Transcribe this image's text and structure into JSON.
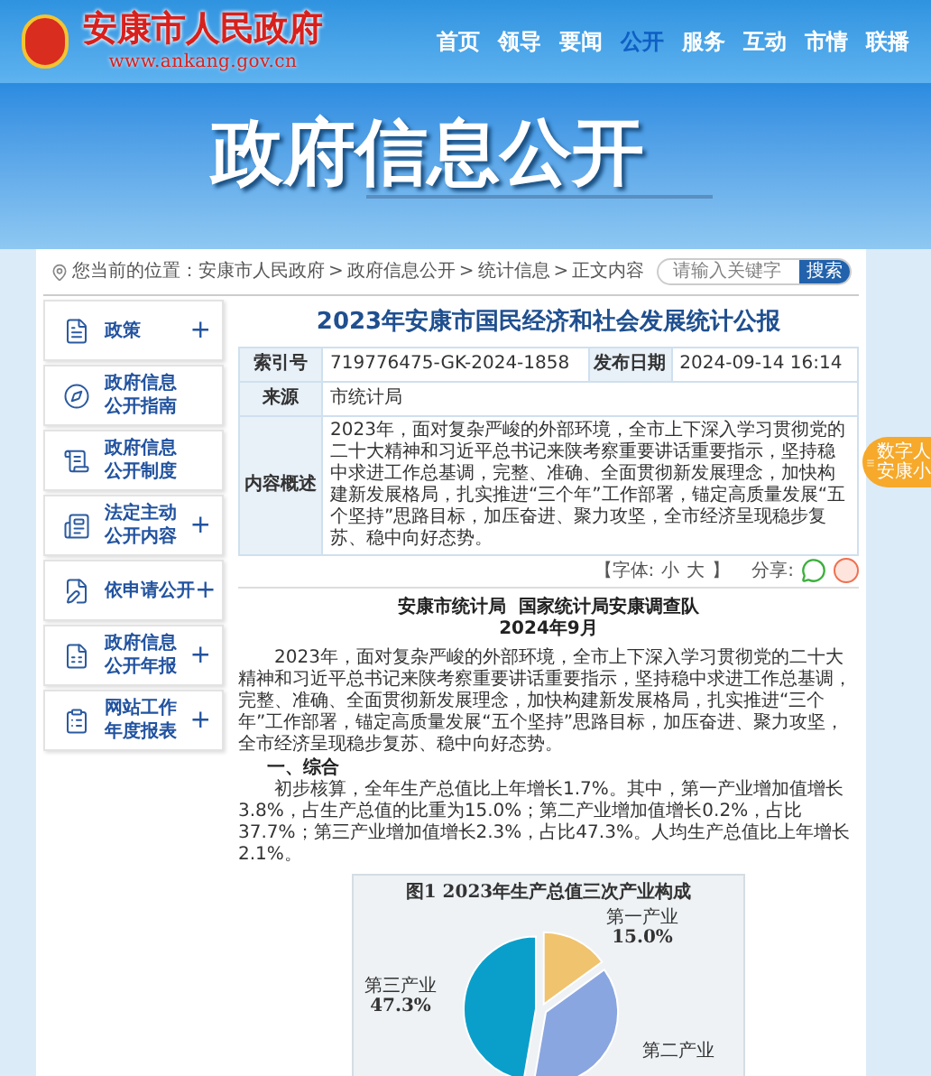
{
  "site": {
    "name": "安康市人民政府",
    "url": "www.ankang.gov.cn"
  },
  "nav": [
    {
      "label": "首页",
      "selected": false
    },
    {
      "label": "领导",
      "selected": false
    },
    {
      "label": "要闻",
      "selected": false
    },
    {
      "label": "公开",
      "selected": true
    },
    {
      "label": "服务",
      "selected": false
    },
    {
      "label": "互动",
      "selected": false
    },
    {
      "label": "市情",
      "selected": false
    },
    {
      "label": "联播",
      "selected": false
    }
  ],
  "banner": {
    "title": "政府信息公开"
  },
  "breadcrumb": {
    "label": "您当前的位置：",
    "items": [
      "安康市人民政府",
      "政府信息公开",
      "统计信息",
      "正文内容"
    ],
    "separator": ">"
  },
  "search": {
    "placeholder": "请输入关键字",
    "button": "搜索"
  },
  "sidebar": {
    "items": [
      {
        "lines": [
          "政策"
        ],
        "toggle": "+"
      },
      {
        "lines": [
          "政府信息",
          "公开指南"
        ]
      },
      {
        "lines": [
          "政府信息",
          "公开制度"
        ]
      },
      {
        "lines": [
          "法定主动",
          "公开内容"
        ],
        "toggle": "+"
      },
      {
        "lines": [
          "依申请公开"
        ],
        "toggle": "+"
      },
      {
        "lines": [
          "政府信息",
          "公开年报"
        ],
        "toggle": "+"
      },
      {
        "lines": [
          "网站工作",
          "年度报表"
        ],
        "toggle": "+"
      }
    ]
  },
  "article": {
    "title": "2023年安康市国民经济和社会发展统计公报",
    "meta": {
      "index_label": "索引号",
      "index": "719776475-GK-2024-1858",
      "date_label": "发布日期",
      "date": "2024-09-14 16:14",
      "source_label": "来源",
      "source": "市统计局",
      "summary_label": "内容概述",
      "summary": "2023年，面对复杂严峻的外部环境，全市上下深入学习贯彻党的二十大精神和习近平总书记来陕考察重要讲话重要指示，坚持稳中求进工作总基调，完整、准确、全面贯彻新发展理念，加快构建新发展格局，扎实推进“三个年”工作部署，锚定高质量发展“五个坚持”思路目标，加压奋进、聚力攻坚，全市经济呈现稳步复苏、稳中向好态势。"
    },
    "font_size": {
      "label": "【字体:",
      "options": [
        "小",
        "大"
      ],
      "close": "】"
    },
    "share": {
      "label": "分享:"
    },
    "authors": "安康市统计局  国家统计局安康调查队",
    "date": "2024年9月",
    "intro": "2023年，面对复杂严峻的外部环境，全市上下深入学习贯彻党的二十大精神和习近平总书记来陕考察重要讲话重要指示，坚持稳中求进工作总基调，完整、准确、全面贯彻新发展理念，加快构建新发展格局，扎实推进“三个年”工作部署，锚定高质量发展“五个坚持”思路目标，加压奋进、聚力攻坚，全市经济呈现稳步复苏、稳中向好态势。",
    "section_heading": "一、综合",
    "section_text": "初步核算，全年生产总值比上年增长1.7%。其中，第一产业增加值增长3.8%，占生产总值的比重为15.0%；第二产业增加值增长0.2%，占比37.7%；第三产业增加值增长2.3%，占比47.3%。人均生产总值比上年增长2.1%。",
    "chart": {
      "title": "图1 2023年生产总值三次产业构成",
      "labels": [
        {
          "name": "第一产业",
          "value": "15.0%"
        },
        {
          "name": "第二产业"
        },
        {
          "name": "第三产业",
          "value": "47.3%"
        }
      ]
    }
  },
  "float_badge": {
    "lines": [
      "数字人",
      "安康小"
    ]
  }
}
